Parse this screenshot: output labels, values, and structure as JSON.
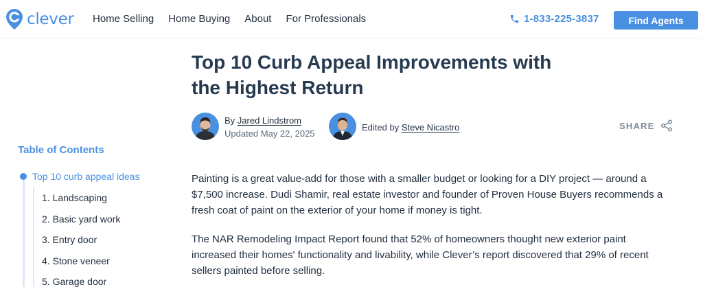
{
  "header": {
    "logo_text": "clever",
    "nav": [
      "Home Selling",
      "Home Buying",
      "About",
      "For Professionals"
    ],
    "phone": "1-833-225-3837",
    "cta": "Find Agents"
  },
  "article": {
    "title": "Top 10 Curb Appeal Improvements with the Highest Return",
    "by_prefix": "By",
    "author": "Jared Lindstrom",
    "updated": "Updated May 22, 2025",
    "edited_prefix": "Edited by",
    "editor": "Steve Nicastro",
    "share": "SHARE"
  },
  "toc": {
    "title": "Table of Contents",
    "active": "Top 10 curb appeal ideas",
    "items": [
      "1. Landscaping",
      "2. Basic yard work",
      "3. Entry door",
      "4. Stone veneer",
      "5. Garage door"
    ]
  },
  "body": {
    "paragraphs": [
      "Painting is a great value-add for those with a smaller budget or looking for a DIY project — around a $7,500 increase. Dudi Shamir, real estate investor and founder of Proven House Buyers recommends a fresh coat of paint on the exterior of your home if money is tight.",
      "The NAR Remodeling Impact Report found that 52% of homeowners thought new exterior paint increased their homes' functionality and livability, while Clever’s report discovered that 29% of recent sellers painted before selling."
    ]
  },
  "colors": {
    "brand": "#4a90e2",
    "heading": "#263a50",
    "text": "#1f2d3d"
  },
  "icons": [
    "clever-logo-icon",
    "phone-icon",
    "share-icon"
  ]
}
